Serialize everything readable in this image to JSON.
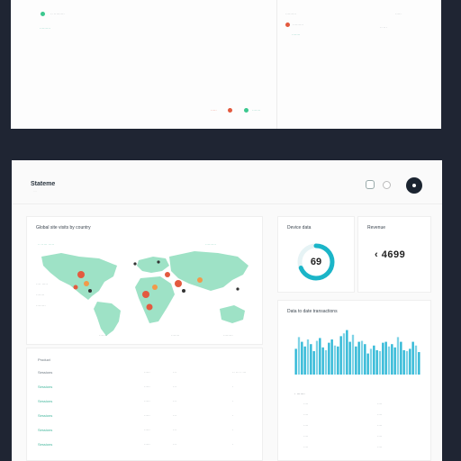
{
  "top_panel": {
    "rows_left": [
      "·· ·········",
      "·········"
    ],
    "rows_right": [
      "·········",
      "·····"
    ],
    "legend_right": [
      "·········",
      "·······"
    ],
    "row_right_values": [
      "·····",
      "·· ···"
    ],
    "legend_bottom": [
      "·····",
      "·······"
    ]
  },
  "header": {
    "brand": "Stateme",
    "subtitle": "····",
    "icons": [
      "panel-icon",
      "circle-icon",
      "avatar"
    ]
  },
  "map_panel": {
    "title": "Global site visits by country",
    "legend": [
      "·· ····· ·····",
      "·········"
    ],
    "labels_left": [
      "···· ·····",
      "·······",
      "········"
    ],
    "labels_bottom": [
      "·······",
      "·······",
      "········"
    ],
    "colors": {
      "land": "#9ee2c6",
      "marker_red": "#e35a3f",
      "marker_orange": "#f2994a"
    }
  },
  "kpi_donut": {
    "title": "Device data",
    "value": "69",
    "accent": "#1bb5c8"
  },
  "kpi_total": {
    "title": "Revenue",
    "value": "‹ 4699"
  },
  "bar_panel": {
    "title": "Data to date transactions",
    "accent": "#2cb7d6"
  },
  "table_left": {
    "header": [
      "Product",
      "",
      ""
    ],
    "rows": [
      [
        "Sessions",
        "·····",
        "···",
        "·· ··· · ···"
      ],
      [
        "Sessions",
        "·····",
        "···",
        "·"
      ],
      [
        "Sessions",
        "·····",
        "···",
        "·"
      ],
      [
        "Sessions",
        "·····",
        "···",
        "·"
      ],
      [
        "Sessions",
        "·····",
        "···",
        "·"
      ],
      [
        "Sessions",
        "·····",
        "···",
        "·"
      ]
    ]
  },
  "table_right": {
    "header": [
      "· ·······",
      ""
    ],
    "rows": [
      [
        "····",
        "····"
      ],
      [
        "····",
        "····"
      ],
      [
        "····",
        "····"
      ],
      [
        "····",
        "····"
      ],
      [
        "····",
        "····"
      ]
    ]
  },
  "chart_data": {
    "type": "bar",
    "title": "Data to date transactions",
    "categories": [
      "1",
      "2",
      "3",
      "4",
      "5",
      "6",
      "7",
      "8",
      "9",
      "10",
      "11",
      "12",
      "13",
      "14",
      "15",
      "16",
      "17",
      "18",
      "19",
      "20",
      "21",
      "22",
      "23",
      "24",
      "25",
      "26",
      "27",
      "28",
      "29",
      "30",
      "31",
      "32",
      "33",
      "34",
      "35",
      "36",
      "37",
      "38",
      "39",
      "40",
      "41",
      "42"
    ],
    "values": [
      55,
      80,
      70,
      60,
      75,
      65,
      50,
      72,
      78,
      58,
      52,
      68,
      75,
      62,
      60,
      82,
      88,
      95,
      70,
      85,
      60,
      70,
      72,
      65,
      45,
      55,
      62,
      52,
      50,
      68,
      70,
      60,
      65,
      58,
      80,
      70,
      52,
      50,
      55,
      70,
      62,
      48
    ],
    "ylim": [
      0,
      100
    ]
  }
}
